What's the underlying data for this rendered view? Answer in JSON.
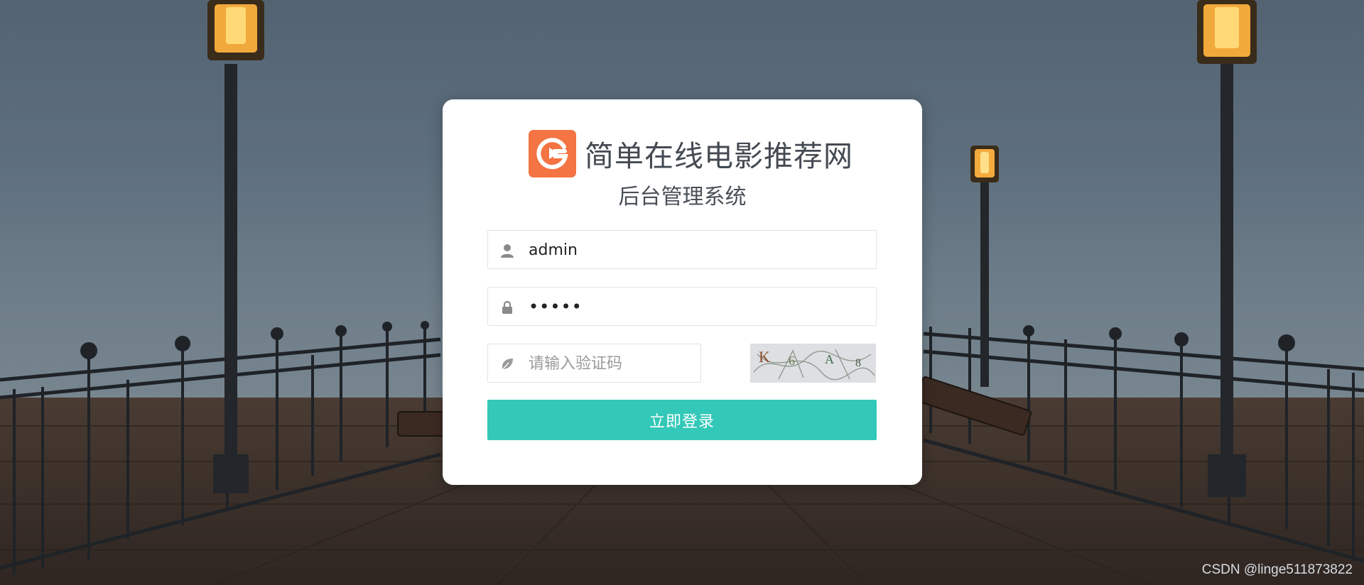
{
  "brand": {
    "title": "简单在线电影推荐网",
    "subtitle": "后台管理系统",
    "logo_color": "#f47443"
  },
  "form": {
    "username": {
      "value": "admin",
      "icon": "user-icon"
    },
    "password": {
      "value": "•••••",
      "icon": "lock-icon"
    },
    "captcha": {
      "placeholder": "请输入验证码",
      "icon": "leaf-icon",
      "image_text": "K6A8"
    },
    "submit_label": "立即登录"
  },
  "colors": {
    "accent": "#33c8b8",
    "card": "#ffffff"
  },
  "watermark": "CSDN @linge511873822"
}
